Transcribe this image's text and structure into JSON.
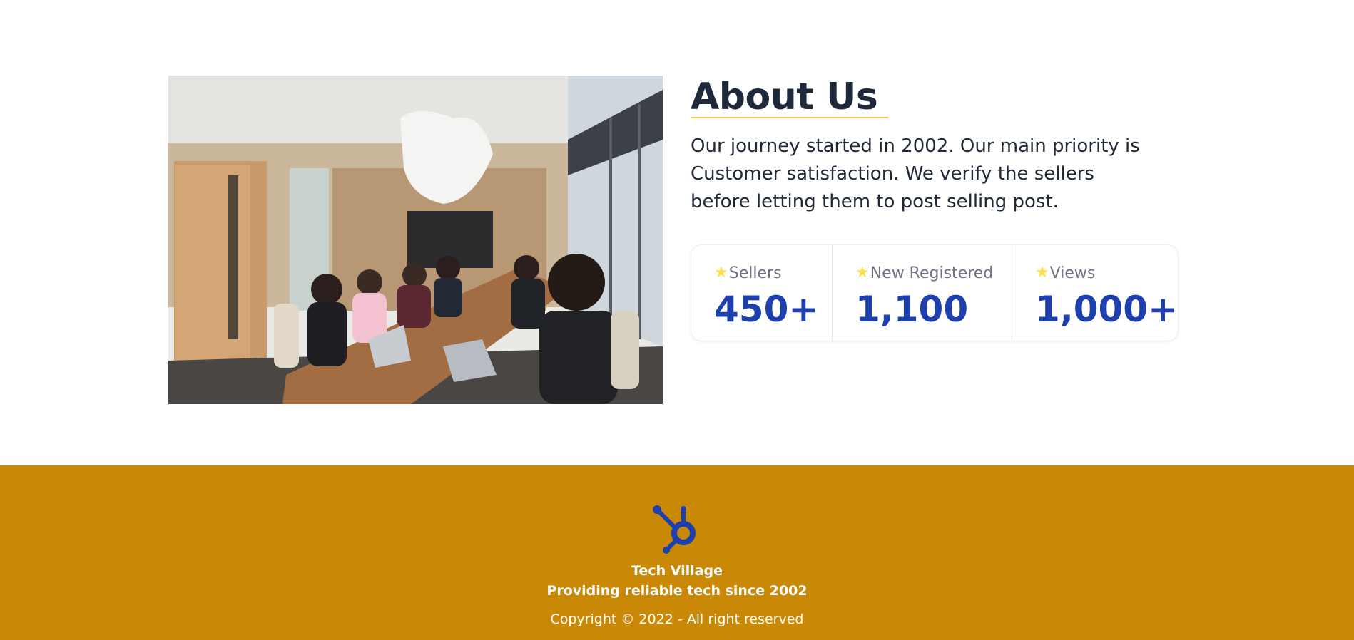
{
  "about": {
    "title": "About Us",
    "description": "Our journey started in 2002. Our main priority is Customer satisfaction. We verify the sellers before letting them to post selling post.",
    "image_icon": "office-meeting-photo",
    "stats": [
      {
        "icon": "star-icon",
        "label": "Sellers",
        "value": "450+"
      },
      {
        "icon": "star-icon",
        "label": "New Registered",
        "value": "1,100"
      },
      {
        "icon": "star-icon",
        "label": "Views",
        "value": "1,000+"
      }
    ]
  },
  "footer": {
    "logo_icon": "hubspot-sprocket-icon",
    "brand": "Tech Village",
    "tagline": "Providing reliable tech since 2002",
    "copyright": "Copyright © 2022 - All right reserved"
  },
  "colors": {
    "accent_blue": "#1e3fae",
    "footer_bg": "#c98805",
    "star": "#fde047",
    "underline": "#f2c14e"
  }
}
